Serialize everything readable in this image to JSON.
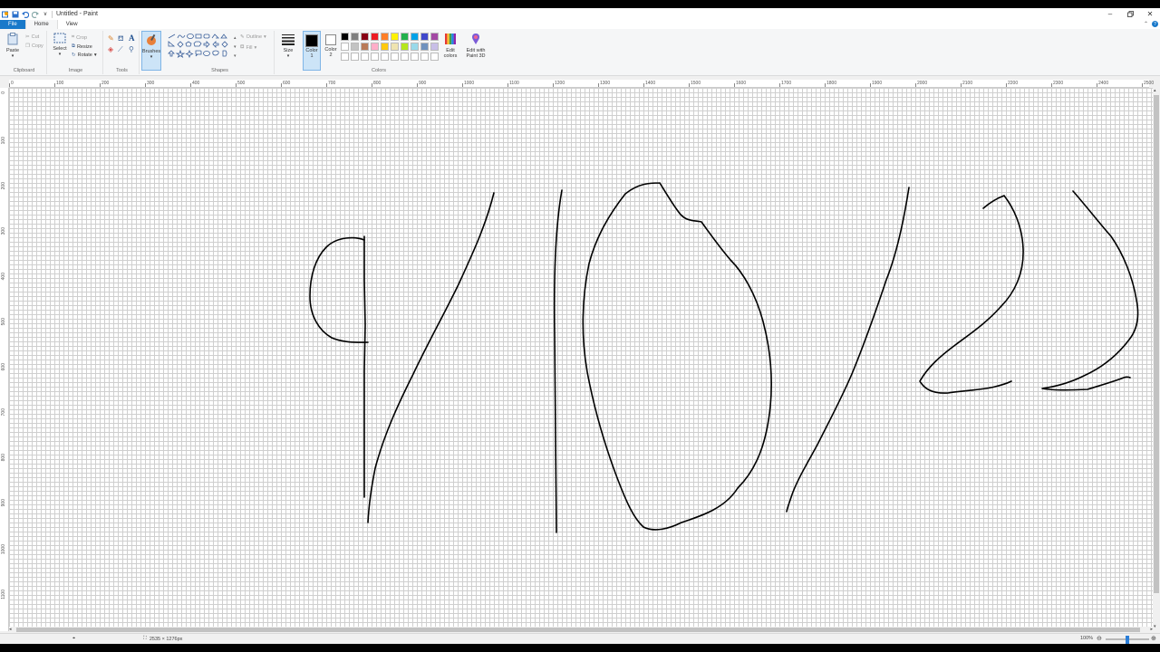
{
  "window": {
    "title": "Untitled - Paint",
    "controls": [
      "minimize",
      "restore",
      "close"
    ]
  },
  "quick_access": [
    "paint-app-icon",
    "save-icon",
    "undo-icon",
    "redo-icon",
    "customize-dropdown-icon"
  ],
  "menu": {
    "tabs": [
      "File",
      "Home",
      "View"
    ]
  },
  "ribbon": {
    "clipboard": {
      "paste": "Paste",
      "cut": "Cut",
      "copy": "Copy",
      "label": "Clipboard"
    },
    "image": {
      "select": "Select",
      "crop": "Crop",
      "resize": "Resize",
      "rotate": "Rotate",
      "label": "Image"
    },
    "tools": {
      "label": "Tools",
      "items": [
        "pencil-icon",
        "fill-icon",
        "text-icon",
        "eraser-icon",
        "color-picker-icon",
        "magnifier-icon"
      ]
    },
    "brushes": {
      "label": "Brushes"
    },
    "shapes": {
      "label": "Shapes",
      "outline": "Outline",
      "fill": "Fill"
    },
    "size": {
      "label": "Size"
    },
    "colors": {
      "color1": "Color",
      "color1_num": "1",
      "color2": "Color",
      "color2_num": "2",
      "label": "Colors",
      "edit_colors_line1": "Edit",
      "edit_colors_line2": "colors",
      "edit_3d_line1": "Edit with",
      "edit_3d_line2": "Paint 3D",
      "color1_value": "#000000",
      "color2_value": "#ffffff",
      "palette_row1": [
        "#000000",
        "#7f7f7f",
        "#880015",
        "#ed1c24",
        "#ff7f27",
        "#fff200",
        "#22b14c",
        "#00a2e8",
        "#3f48cc",
        "#a349a4"
      ],
      "palette_row2": [
        "#ffffff",
        "#c3c3c3",
        "#b97a57",
        "#ffaec9",
        "#ffc90e",
        "#efe4b0",
        "#b5e61d",
        "#99d9ea",
        "#7092be",
        "#c8bfe7"
      ]
    }
  },
  "rulers": {
    "horizontal": [
      "0",
      "100",
      "200",
      "300",
      "400",
      "500",
      "600",
      "700",
      "800",
      "900",
      "1000",
      "1100",
      "1200",
      "1300",
      "1400",
      "1500",
      "1600",
      "1700",
      "1800",
      "1900",
      "2000",
      "2100",
      "2200",
      "2300",
      "2400",
      "2500"
    ],
    "vertical": [
      "0",
      "100",
      "200",
      "300",
      "400",
      "500",
      "600",
      "700",
      "800",
      "900",
      "1000",
      "1100"
    ]
  },
  "status": {
    "canvas_size": "2535 × 1276px",
    "zoom": "100%",
    "zoom_fraction": 0.5
  }
}
